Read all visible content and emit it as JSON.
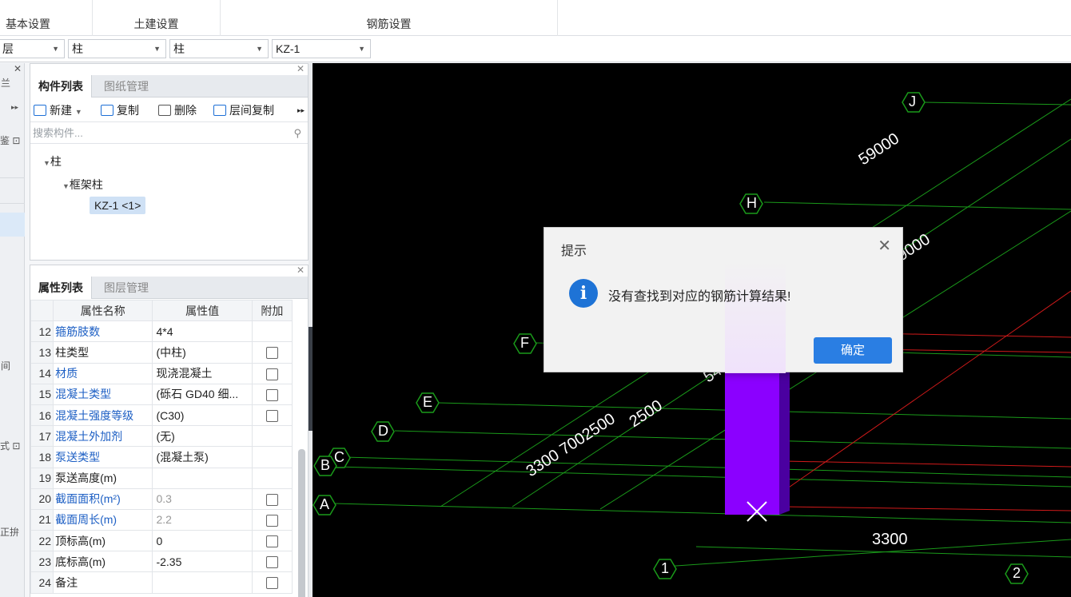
{
  "menu": {
    "basic": "基本设置",
    "civil": "土建设置",
    "rebar": "钢筋设置"
  },
  "selectors": {
    "floor": "层",
    "type1": "柱",
    "type2": "柱",
    "component": "KZ-1"
  },
  "left_strip": {
    "top_glyph": "兰",
    "glyph2": "鉴",
    "glyph3": "间",
    "glyph4": "式",
    "glyph5": "正拚"
  },
  "component_panel": {
    "tab_active": "构件列表",
    "tab_other": "图纸管理",
    "toolbar": {
      "new": "新建",
      "copy": "复制",
      "delete": "删除",
      "floor_copy": "层间复制"
    },
    "search_placeholder": "搜索构件...",
    "tree": {
      "root": "柱",
      "child": "框架柱",
      "leaf": "KZ-1 <1>"
    }
  },
  "property_panel": {
    "tab_active": "属性列表",
    "tab_other": "图层管理",
    "headers": {
      "name": "属性名称",
      "value": "属性值",
      "extra": "附加"
    },
    "rows": [
      {
        "num": "12",
        "name": "箍筋肢数",
        "value": "4*4"
      },
      {
        "num": "13",
        "name": "柱类型",
        "value": "(中柱)"
      },
      {
        "num": "14",
        "name": "材质",
        "value": "现浇混凝土"
      },
      {
        "num": "15",
        "name": "混凝土类型",
        "value": "(砾石 GD40 细..."
      },
      {
        "num": "16",
        "name": "混凝土强度等级",
        "value": "(C30)"
      },
      {
        "num": "17",
        "name": "混凝土外加剂",
        "value": "(无)"
      },
      {
        "num": "18",
        "name": "泵送类型",
        "value": "(混凝土泵)"
      },
      {
        "num": "19",
        "name": "泵送高度(m)",
        "value": ""
      },
      {
        "num": "20",
        "name": "截面面积(m²)",
        "value": "0.3"
      },
      {
        "num": "21",
        "name": "截面周长(m)",
        "value": "2.2"
      },
      {
        "num": "22",
        "name": "顶标高(m)",
        "value": "0"
      },
      {
        "num": "23",
        "name": "底标高(m)",
        "value": "-2.35"
      },
      {
        "num": "24",
        "name": "备注",
        "value": ""
      }
    ]
  },
  "viewport": {
    "axes": {
      "J": "J",
      "H": "H",
      "F": "F",
      "E": "E",
      "D": "D",
      "C": "C",
      "B": "B",
      "A": "A",
      "n1": "1",
      "n2": "2"
    },
    "dims": {
      "d59000": "59000",
      "d9000": "9000",
      "d54": "54",
      "d2500": "2500",
      "d3300_7002500": "3300 7002500",
      "d3300": "3300"
    },
    "colors": {
      "grid_green": "#1a9a1a",
      "grid_red": "#d11a1a",
      "column": "#8b00ff",
      "column_side": "#4a00a0"
    }
  },
  "dialog": {
    "title": "提示",
    "message": "没有查找到对应的钢筋计算结果!",
    "ok": "确定"
  }
}
